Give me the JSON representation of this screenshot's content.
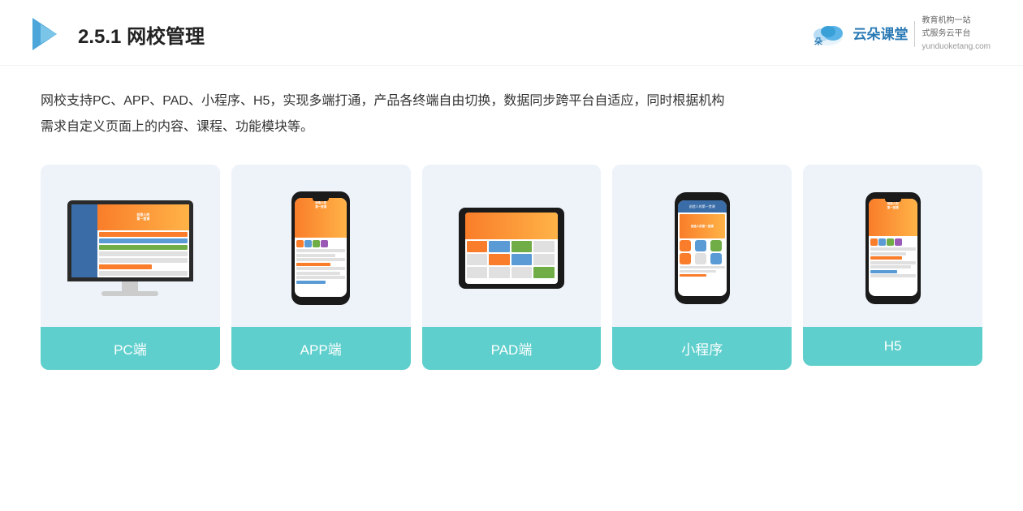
{
  "header": {
    "section_number": "2.5.1",
    "title": "网校管理",
    "brand": {
      "cloud_text": "云朵课堂",
      "url": "yunduoketang.com",
      "tagline_line1": "教育机构一站",
      "tagline_line2": "式服务云平台"
    }
  },
  "description": {
    "line1": "网校支持PC、APP、PAD、小程序、H5，实现多端打通，产品各终端自由切换，数据同步跨平台自适应，同时根据机构",
    "line2": "需求自定义页面上的内容、课程、功能模块等。"
  },
  "cards": [
    {
      "id": "pc",
      "label": "PC端"
    },
    {
      "id": "app",
      "label": "APP端"
    },
    {
      "id": "pad",
      "label": "PAD端"
    },
    {
      "id": "miniapp",
      "label": "小程序"
    },
    {
      "id": "h5",
      "label": "H5"
    }
  ]
}
